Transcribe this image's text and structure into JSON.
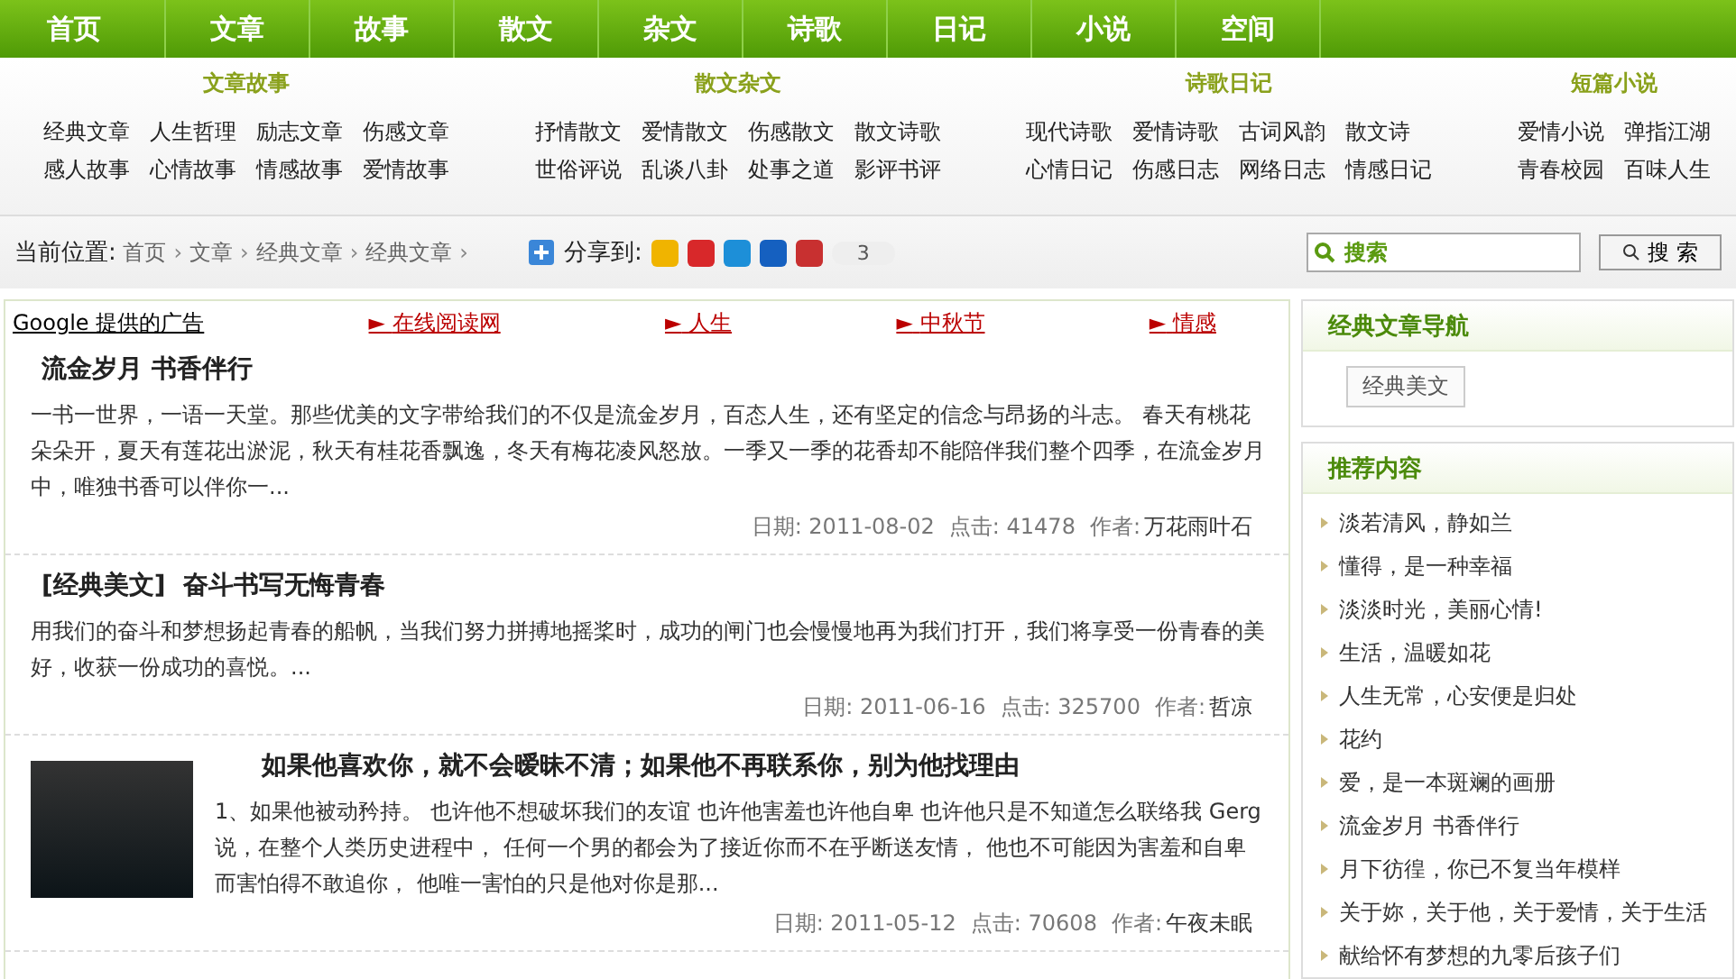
{
  "nav": [
    {
      "label": "首页",
      "selected": false
    },
    {
      "label": "文章",
      "selected": false
    },
    {
      "label": "故事",
      "selected": false
    },
    {
      "label": "散文",
      "selected": false
    },
    {
      "label": "杂文",
      "selected": false
    },
    {
      "label": "诗歌",
      "selected": false
    },
    {
      "label": "日记",
      "selected": false
    },
    {
      "label": "小说",
      "selected": false
    },
    {
      "label": "空间",
      "selected": false
    }
  ],
  "categories": [
    {
      "title": "文章故事",
      "links": [
        "经典文章",
        "人生哲理",
        "励志文章",
        "伤感文章",
        "感人故事",
        "心情故事",
        "情感故事",
        "爱情故事"
      ]
    },
    {
      "title": "散文杂文",
      "links": [
        "抒情散文",
        "爱情散文",
        "伤感散文",
        "散文诗歌",
        "世俗评说",
        "乱谈八卦",
        "处事之道",
        "影评书评"
      ]
    },
    {
      "title": "诗歌日记",
      "links": [
        "现代诗歌",
        "爱情诗歌",
        "古词风韵",
        "散文诗",
        "心情日记",
        "伤感日志",
        "网络日志",
        "情感日记"
      ]
    },
    {
      "title": "短篇小说",
      "links": [
        "爱情小说",
        "弹指江湖",
        "青春校园",
        "百味人生"
      ]
    }
  ],
  "breadcrumb": {
    "label": "当前位置:",
    "items": [
      "首页",
      "文章",
      "经典文章",
      "经典文章"
    ],
    "separator": "›"
  },
  "share": {
    "label": "分享到:",
    "icons": [
      {
        "color": "#f0b400"
      },
      {
        "color": "#d8282a"
      },
      {
        "color": "#1d8fd8"
      },
      {
        "color": "#1560c0"
      },
      {
        "color": "#c83030"
      }
    ],
    "count": "3"
  },
  "search": {
    "placeholder": "搜索",
    "button": "搜 索"
  },
  "ads": {
    "label": "Google 提供的广告",
    "links": [
      "在线阅读网",
      "人生",
      "中秋节",
      "情感"
    ],
    "marker": "►"
  },
  "articles": [
    {
      "title": "流金岁月 书香伴行",
      "has_image": false,
      "summary": "一书一世界，一语一天堂。那些优美的文字带给我们的不仅是流金岁月，百态人生，还有坚定的信念与昂扬的斗志。 春天有桃花朵朵开，夏天有莲花出淤泥，秋天有桂花香飘逸，冬天有梅花凌风怒放。一季又一季的花香却不能陪伴我们整个四季，在流金岁月中，唯独书香可以伴你一...",
      "date": "日期: 2011-08-02",
      "hits": "点击: 41478",
      "author_label": "作者:",
      "author": "万花雨叶石"
    },
    {
      "tag": "[经典美文]",
      "title": "奋斗书写无悔青春",
      "has_image": false,
      "summary": "用我们的奋斗和梦想扬起青春的船帆，当我们努力拼搏地摇桨时，成功的闸门也会慢慢地再为我们打开，我们将享受一份青春的美好，收获一份成功的喜悦。...",
      "date": "日期: 2011-06-16",
      "hits": "点击: 325700",
      "author_label": "作者:",
      "author": "哲凉"
    },
    {
      "title": "如果他喜欢你，就不会暧昧不清；如果他不再联系你，别为他找理由",
      "has_image": true,
      "summary": "1、如果他被动矜持。 也许他不想破坏我们的友谊 也许他害羞也许他自卑 也许他只是不知道怎么联络我 Gerg说，在整个人类历史进程中， 任何一个男的都会为了接近你而不在乎断送友情， 他也不可能因为害羞和自卑而害怕得不敢追你， 他唯一害怕的只是他对你是那...",
      "date": "日期: 2011-05-12",
      "hits": "点击: 70608",
      "author_label": "作者:",
      "author": "午夜未眠"
    }
  ],
  "sidebar_nav": {
    "title": "经典文章导航",
    "tags": [
      "经典美文"
    ]
  },
  "recommend": {
    "title": "推荐内容",
    "items": [
      "淡若清风，静如兰",
      "懂得，是一种幸福",
      "淡淡时光，美丽心情!",
      "生活，温暖如花",
      "人生无常，心安便是归处",
      "花约",
      "爱，是一本斑斓的画册",
      "流金岁月 书香伴行",
      "月下彷徨，你已不复当年模样",
      "关于妳，关于他，关于爱情，关于生活",
      "献给怀有梦想的九零后孩子们"
    ]
  }
}
